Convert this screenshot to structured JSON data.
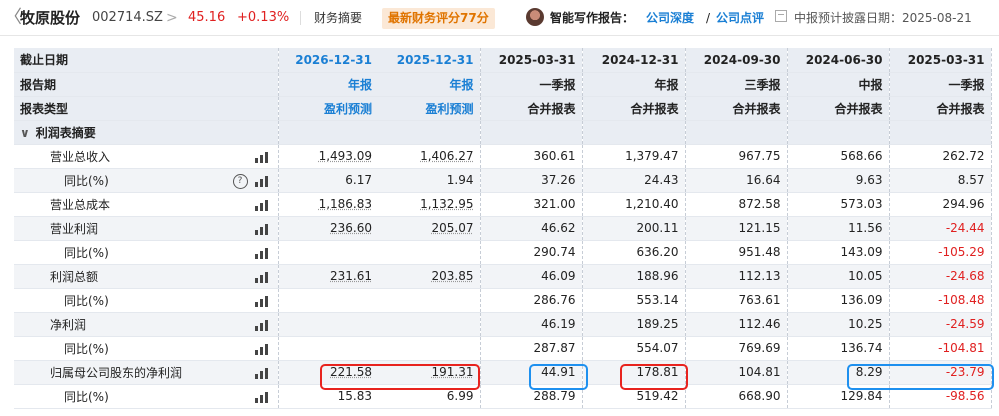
{
  "header": {
    "back_glyph": "〈",
    "stock_name": "牧原股份",
    "stock_code": "002714.SZ",
    "chevron": ">",
    "price": "45.16",
    "change_pct": "+0.13%",
    "tab_summary": "财务摘要",
    "rating_badge": "最新财务评分77分",
    "report_label": "智能写作报告：",
    "link_depth": "公司深度",
    "slash": "/",
    "link_review": "公司点评",
    "disclosure": "中报预计披露日期：2025-08-21"
  },
  "table": {
    "header_rows": [
      {
        "label": "截止日期",
        "cells": [
          "2026-12-31",
          "2025-12-31",
          "2025-03-31",
          "2024-12-31",
          "2024-09-30",
          "2024-06-30",
          "2025-03-31"
        ]
      },
      {
        "label": "报告期",
        "cells": [
          "年报",
          "年报",
          "一季报",
          "年报",
          "三季报",
          "中报",
          "一季报"
        ]
      },
      {
        "label": "报表类型",
        "cells": [
          "盈利预测",
          "盈利预测",
          "合并报表",
          "合并报表",
          "合并报表",
          "合并报表",
          "合并报表"
        ]
      }
    ],
    "section_title": "利润表摘要",
    "rows": [
      {
        "label": "营业总收入",
        "cells": [
          "1,493.09",
          "1,406.27",
          "360.61",
          "1,379.47",
          "967.75",
          "568.66",
          "262.72"
        ]
      },
      {
        "label": "同比(%)",
        "cells": [
          "6.17",
          "1.94",
          "37.26",
          "24.43",
          "16.64",
          "9.63",
          "8.57"
        ]
      },
      {
        "label": "营业总成本",
        "cells": [
          "1,186.83",
          "1,132.95",
          "321.00",
          "1,210.40",
          "872.58",
          "573.03",
          "294.96"
        ]
      },
      {
        "label": "营业利润",
        "cells": [
          "236.60",
          "205.07",
          "46.62",
          "200.11",
          "121.15",
          "11.56",
          "-24.44"
        ]
      },
      {
        "label": "同比(%)",
        "cells": [
          "",
          "",
          "290.74",
          "636.20",
          "951.48",
          "143.09",
          "-105.29"
        ]
      },
      {
        "label": "利润总额",
        "cells": [
          "231.61",
          "203.85",
          "46.09",
          "188.96",
          "112.13",
          "10.05",
          "-24.68"
        ]
      },
      {
        "label": "同比(%)",
        "cells": [
          "",
          "",
          "286.76",
          "553.14",
          "763.61",
          "136.09",
          "-108.48"
        ]
      },
      {
        "label": "净利润",
        "cells": [
          "",
          "",
          "46.19",
          "189.25",
          "112.46",
          "10.25",
          "-24.59"
        ]
      },
      {
        "label": "同比(%)",
        "cells": [
          "",
          "",
          "287.87",
          "554.07",
          "769.69",
          "136.74",
          "-104.81"
        ]
      },
      {
        "label": "归属母公司股东的净利润",
        "cells": [
          "221.58",
          "191.31",
          "44.91",
          "178.81",
          "104.81",
          "8.29",
          "-23.79"
        ]
      },
      {
        "label": "同比(%)",
        "cells": [
          "15.83",
          "6.99",
          "288.79",
          "519.42",
          "668.90",
          "129.84",
          "-98.56"
        ]
      }
    ]
  },
  "colors": {
    "accent_blue": "#1a7fd4",
    "negative_red": "#e02020",
    "highlight_red": "#e8231e",
    "highlight_blue": "#1e90ef",
    "rating_orange": "#e07400"
  },
  "icons": [
    "back-icon",
    "chevron-right-icon",
    "avatar",
    "calendar-icon",
    "caret-down-icon",
    "bar-chart-icon",
    "help-icon"
  ]
}
